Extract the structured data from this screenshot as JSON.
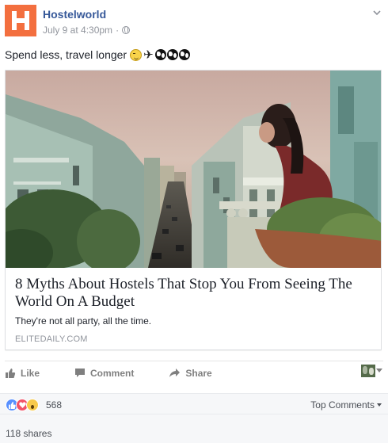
{
  "post": {
    "page_name": "Hostelworld",
    "timestamp": "July 9 at 4:30pm",
    "separator": "·",
    "message": "Spend less, travel longer",
    "message_emojis": [
      "wink-face",
      "airplane",
      "globe-africa",
      "globe-africa",
      "globe-africa"
    ],
    "colors": {
      "brand": "#f36f3f",
      "link": "#365899",
      "meta": "#90949c"
    }
  },
  "link_card": {
    "title": "8 Myths About Hostels That Stop You From Seeing The World On A Budget",
    "description": "They're not all party, all the time.",
    "domain": "ELITEDAILY.COM"
  },
  "actions": {
    "like_label": "Like",
    "comment_label": "Comment",
    "share_label": "Share"
  },
  "reactions": {
    "types": [
      "like",
      "love",
      "wow"
    ],
    "count": "568",
    "sort_label": "Top Comments"
  },
  "shares": {
    "label": "118 shares"
  }
}
